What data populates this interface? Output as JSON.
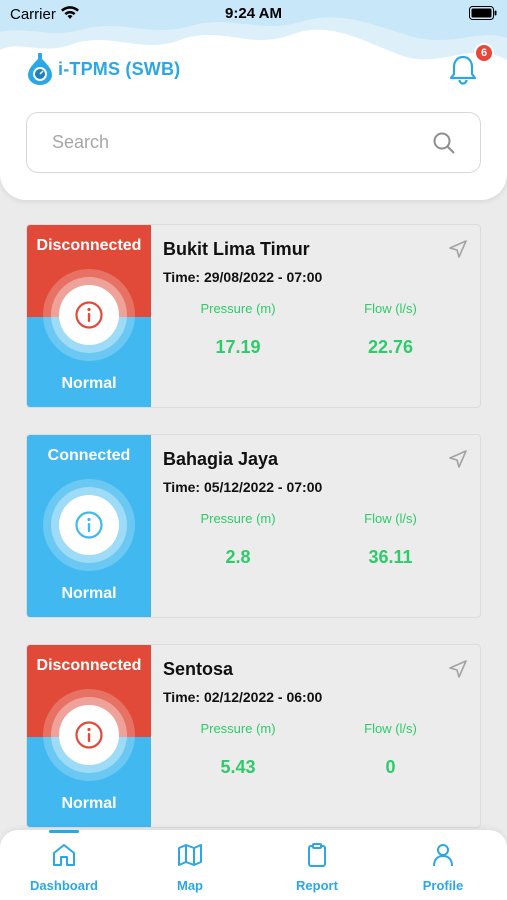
{
  "status_bar": {
    "carrier": "Carrier",
    "time": "9:24 AM"
  },
  "header": {
    "app_title": "i-TPMS (SWB)",
    "notification_count": "6"
  },
  "search": {
    "placeholder": "Search",
    "value": ""
  },
  "colors": {
    "accent": "#2ba7e6",
    "disconnected": "#e14a38",
    "connected": "#41b9f0",
    "value_green": "#2ecb6a",
    "badge": "#e8463a"
  },
  "cards": [
    {
      "status": "Disconnected",
      "condition": "Normal",
      "name": "Bukit Lima Timur",
      "time": "Time: 29/08/2022 - 07:00",
      "pressure_label": "Pressure (m)",
      "flow_label": "Flow (l/s)",
      "pressure": "17.19",
      "flow": "22.76"
    },
    {
      "status": "Connected",
      "condition": "Normal",
      "name": "Bahagia Jaya",
      "time": "Time: 05/12/2022 - 07:00",
      "pressure_label": "Pressure (m)",
      "flow_label": "Flow (l/s)",
      "pressure": "2.8",
      "flow": "36.11"
    },
    {
      "status": "Disconnected",
      "condition": "Normal",
      "name": "Sentosa",
      "time": "Time: 02/12/2022 - 06:00",
      "pressure_label": "Pressure (m)",
      "flow_label": "Flow (l/s)",
      "pressure": "5.43",
      "flow": "0"
    }
  ],
  "tabbar": {
    "items": [
      {
        "label": "Dashboard",
        "icon": "home-icon"
      },
      {
        "label": "Map",
        "icon": "map-icon"
      },
      {
        "label": "Report",
        "icon": "clipboard-icon"
      },
      {
        "label": "Profile",
        "icon": "user-icon"
      }
    ]
  }
}
